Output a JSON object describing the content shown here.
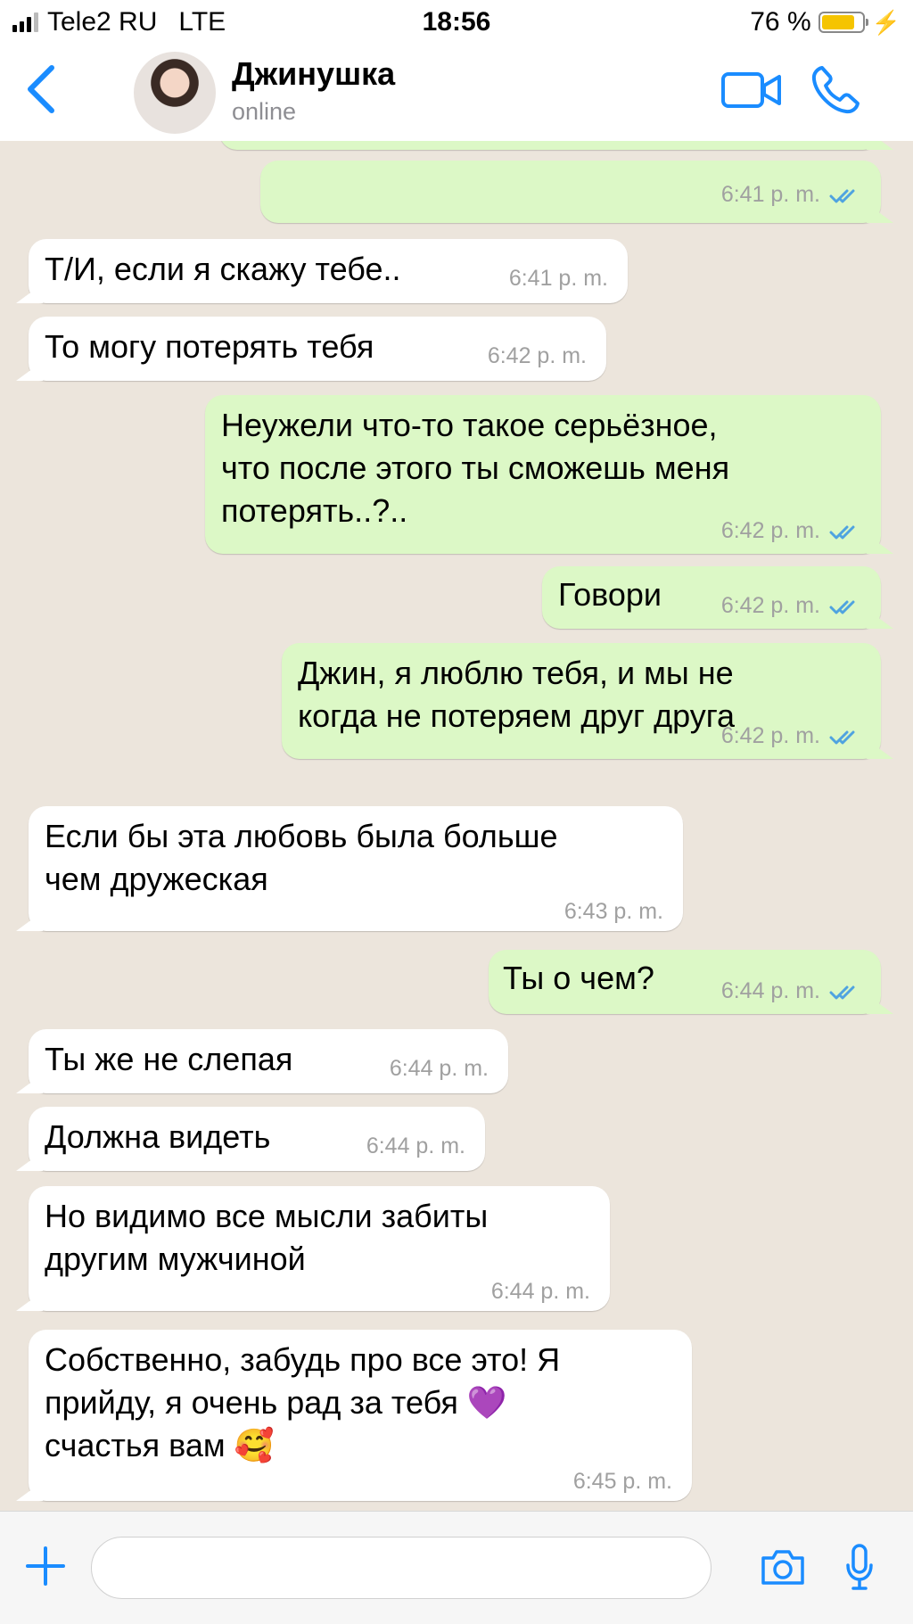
{
  "status_bar": {
    "carrier": "Tele2 RU",
    "network": "LTE",
    "time": "18:56",
    "battery": "76 %",
    "battery_level": 0.76
  },
  "header": {
    "contact_name": "Джинушка",
    "contact_status": "online"
  },
  "messages": [
    {
      "text": "",
      "time": "6:41 p. m.",
      "read": true
    },
    {
      "text": "Т/И, если я скажу тебе..",
      "time": "6:41 p. m."
    },
    {
      "text": "То могу потерять тебя",
      "time": "6:42 p. m."
    },
    {
      "text": "Неужели что-то такое серьёзное,\nчто после этого ты сможешь меня\nпотерять..?..",
      "time": "6:42 p. m.",
      "read": true
    },
    {
      "text": "Говори",
      "time": "6:42 p. m.",
      "read": true
    },
    {
      "text": "Джин, я люблю тебя, и мы не\nкогда не потеряем друг друга",
      "time": "6:42 p. m.",
      "read": true
    },
    {
      "text": "Если бы эта любовь была больше\nчем дружеская",
      "time": "6:43 p. m."
    },
    {
      "text": "Ты о чем?",
      "time": "6:44 p. m.",
      "read": true
    },
    {
      "text": "Ты же не слепая",
      "time": "6:44 p. m."
    },
    {
      "text": "Должна видеть",
      "time": "6:44 p. m."
    },
    {
      "text": "Но видимо все мысли забиты\nдругим мужчиной",
      "time": "6:44 p. m."
    },
    {
      "text": "Собственно, забудь про все это! Я\nприйду, я очень рад за тебя 💜\nсчастья вам 🥰",
      "time": "6:45 p. m."
    }
  ],
  "colors": {
    "accent": "#1a8cff",
    "outgoing_bubble": "#dcf8c6",
    "incoming_bubble": "#ffffff",
    "chat_background": "#ece5dc",
    "read_ticks": "#4fa3e0"
  },
  "icons": [
    "back-chevron",
    "video-camera",
    "phone",
    "plus",
    "camera",
    "microphone",
    "double-check"
  ]
}
